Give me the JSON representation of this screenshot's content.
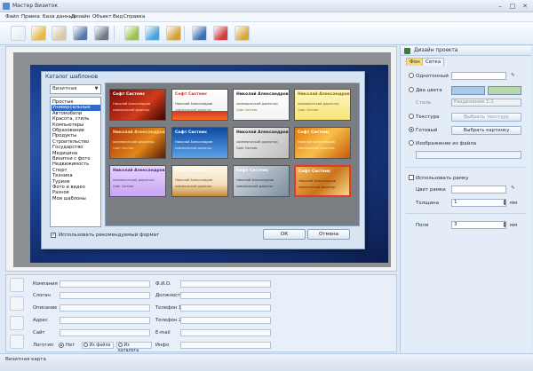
{
  "window": {
    "title": "Мастер Визиток",
    "controls": [
      "–",
      "□",
      "✕"
    ]
  },
  "menu": [
    "Файл",
    "Правка",
    "База данных",
    "Дизайн",
    "Объект",
    "Вид",
    "Справка"
  ],
  "toolbar": {
    "buttons": [
      {
        "name": "new-document-icon",
        "color": "#e8eef6"
      },
      {
        "name": "open-folder-icon",
        "color": "#e4b84a"
      },
      {
        "name": "clipboard-icon",
        "color": "#d9c9a4"
      },
      {
        "name": "save-icon",
        "color": "#5577aa"
      },
      {
        "name": "print-icon",
        "color": "#707a86"
      },
      {
        "name": "wand-icon",
        "color": "#9bc24a"
      },
      {
        "name": "image-icon",
        "color": "#4aa3d8"
      },
      {
        "name": "picture-frame-icon",
        "color": "#d5a13a"
      },
      {
        "name": "zoom-icon",
        "color": "#3b6fb6"
      },
      {
        "name": "help-icon",
        "color": "#d33c3c"
      },
      {
        "name": "settings-icon",
        "color": "#d8a83a"
      }
    ]
  },
  "dialog": {
    "title": "Каталог шаблонов",
    "select_value": "Визитная",
    "categories": [
      "Простые",
      "Универсальные",
      "Автомобили",
      "Красота, стиль",
      "Компьютеры",
      "Образование",
      "Продукты",
      "Строительство",
      "Государство",
      "Медицина",
      "Визитки с фото",
      "Недвижимость",
      "Спорт",
      "Техника",
      "Туризм",
      "Фото и видео",
      "Разное",
      "Мои шаблоны"
    ],
    "selected_category": "Универсальные",
    "thumbnails": [
      {
        "bg": "linear-gradient(135deg,#7a0a0a,#d33a1a 60%,#3a0505)",
        "t1": "Софт Системс",
        "t1c": "#ffffff",
        "t2": "Николай Александров",
        "t2c": "#ffe9a8",
        "t3": "коммерческий директор",
        "t3c": "#ffd7c4"
      },
      {
        "bg": "linear-gradient(180deg,#ffffff,#f3f3f3 70%,#c63b2e 71%,#ff6a1a)",
        "t1": "Софт Системс",
        "t1c": "#c63b2e",
        "t2": "Николай Александров",
        "t2c": "#333333",
        "t3": "коммерческий директор",
        "t3c": "#666666"
      },
      {
        "bg": "linear-gradient(180deg,#ffffff,#f4f4f4)",
        "t1": "Николай Александров",
        "t1c": "#222222",
        "t2": "коммерческий директор",
        "t2c": "#444444",
        "t3": "Софт Системс",
        "t3c": "#5a7a3a"
      },
      {
        "bg": "linear-gradient(180deg,#fff7c2,#f7e57a)",
        "t1": "Николай Александров",
        "t1c": "#8a6d12",
        "t2": "коммерческий директор",
        "t2c": "#6b5a1a",
        "t3": "Софт Системс",
        "t3c": "#8a6d12"
      },
      {
        "bg": "linear-gradient(135deg,#a6320e,#e0861a 60%,#5a1a06)",
        "t1": "Николай Александров",
        "t1c": "#ffe08a",
        "t2": "коммерческий директор",
        "t2c": "#fff0c4",
        "t3": "Софт Системс",
        "t3c": "#ffe08a"
      },
      {
        "bg": "linear-gradient(180deg,#0f4aa0,#5aa3e8)",
        "t1": "Софт Системс",
        "t1c": "#ffffff",
        "t2": "Николай Александров",
        "t2c": "#ffffff",
        "t3": "коммерческий директор",
        "t3c": "#dfefff"
      },
      {
        "bg": "linear-gradient(135deg,#f2f2f2,#bdbdbd)",
        "t1": "Николай Александров",
        "t1c": "#222222",
        "t2": "коммерческий директор",
        "t2c": "#444444",
        "t3": "Софт Системс",
        "t3c": "#333333"
      },
      {
        "bg": "linear-gradient(135deg,#e07a10,#f8c04a 50%,#c85a08)",
        "t1": "Софт Системс",
        "t1c": "#ffffff",
        "t2": "Николай Александров",
        "t2c": "#fff7d8",
        "t3": "коммерческий директор",
        "t3c": "#fff7d8"
      },
      {
        "bg": "linear-gradient(180deg,#e9d6ff,#c7a6f2)",
        "t1": "Николай Александров",
        "t1c": "#4a2a7a",
        "t2": "коммерческий директор",
        "t2c": "#5a3a8a",
        "t3": "Софт Системс",
        "t3c": "#4a2a7a"
      },
      {
        "bg": "linear-gradient(180deg,#fff6e6,#f3e0c0 60%,#c58a3a)",
        "t1": "Софт Системс",
        "t1c": "#ffffff",
        "t2": "Николай Александров",
        "t2c": "#6b4a1a",
        "t3": "коммерческий директор",
        "t3c": "#6b4a1a"
      },
      {
        "bg": "linear-gradient(135deg,#d9dfe6,#7d8ea1)",
        "t1": "Софт Системс",
        "t1c": "#ffffff",
        "t2": "Николай Александров",
        "t2c": "#1f2f44",
        "t3": "коммерческий директор",
        "t3c": "#1f2f44"
      },
      {
        "bg": "linear-gradient(135deg,#f4b85a,#c8741a 55%,#f6d98a)",
        "t1": "Софт Системс",
        "t1c": "#ffffff",
        "t2": "Николай Александров",
        "t2c": "#5a2a06",
        "t3": "коммерческий директор",
        "t3c": "#5a2a06"
      }
    ],
    "recommended_label": "Использовать рекомендуемый формат",
    "ok_label": "ОК",
    "cancel_label": "Отмена"
  },
  "right_panel": {
    "title": "Дизайн проекта",
    "tabs": [
      "Фон",
      "Сетка"
    ],
    "mono_label": "Однотонный",
    "two_colors_label": "Два цвета",
    "two_color_a": "#a9c8ee",
    "two_color_b": "#b7d7ad",
    "style_label": "Стиль",
    "style_value": "Разделение 1:1",
    "texture_label": "Текстура",
    "choose_texture": "Выбрать текстуру",
    "ready_label": "Готовый",
    "choose_picture": "Выбрать картинку",
    "from_file_label": "Изображение из файла",
    "use_frame_label": "Использовать рамку",
    "frame_color_label": "Цвет рамки",
    "thickness_label": "Толщина",
    "thickness_value": "1",
    "margins_label": "Поля",
    "margins_value": "3",
    "unit": "мм"
  },
  "form": {
    "left_labels": [
      "Компания",
      "Слоган",
      "Описание",
      "Адрес",
      "Сайт",
      "Логотип"
    ],
    "right_labels": [
      "Ф.И.О.",
      "Должность",
      "Телефон 1",
      "Телефон 2",
      "E-mail",
      "Инфо"
    ],
    "logo_options": [
      "Нет",
      "Из файла",
      "Из каталога"
    ]
  },
  "status": {
    "text": "Визитная карта"
  }
}
